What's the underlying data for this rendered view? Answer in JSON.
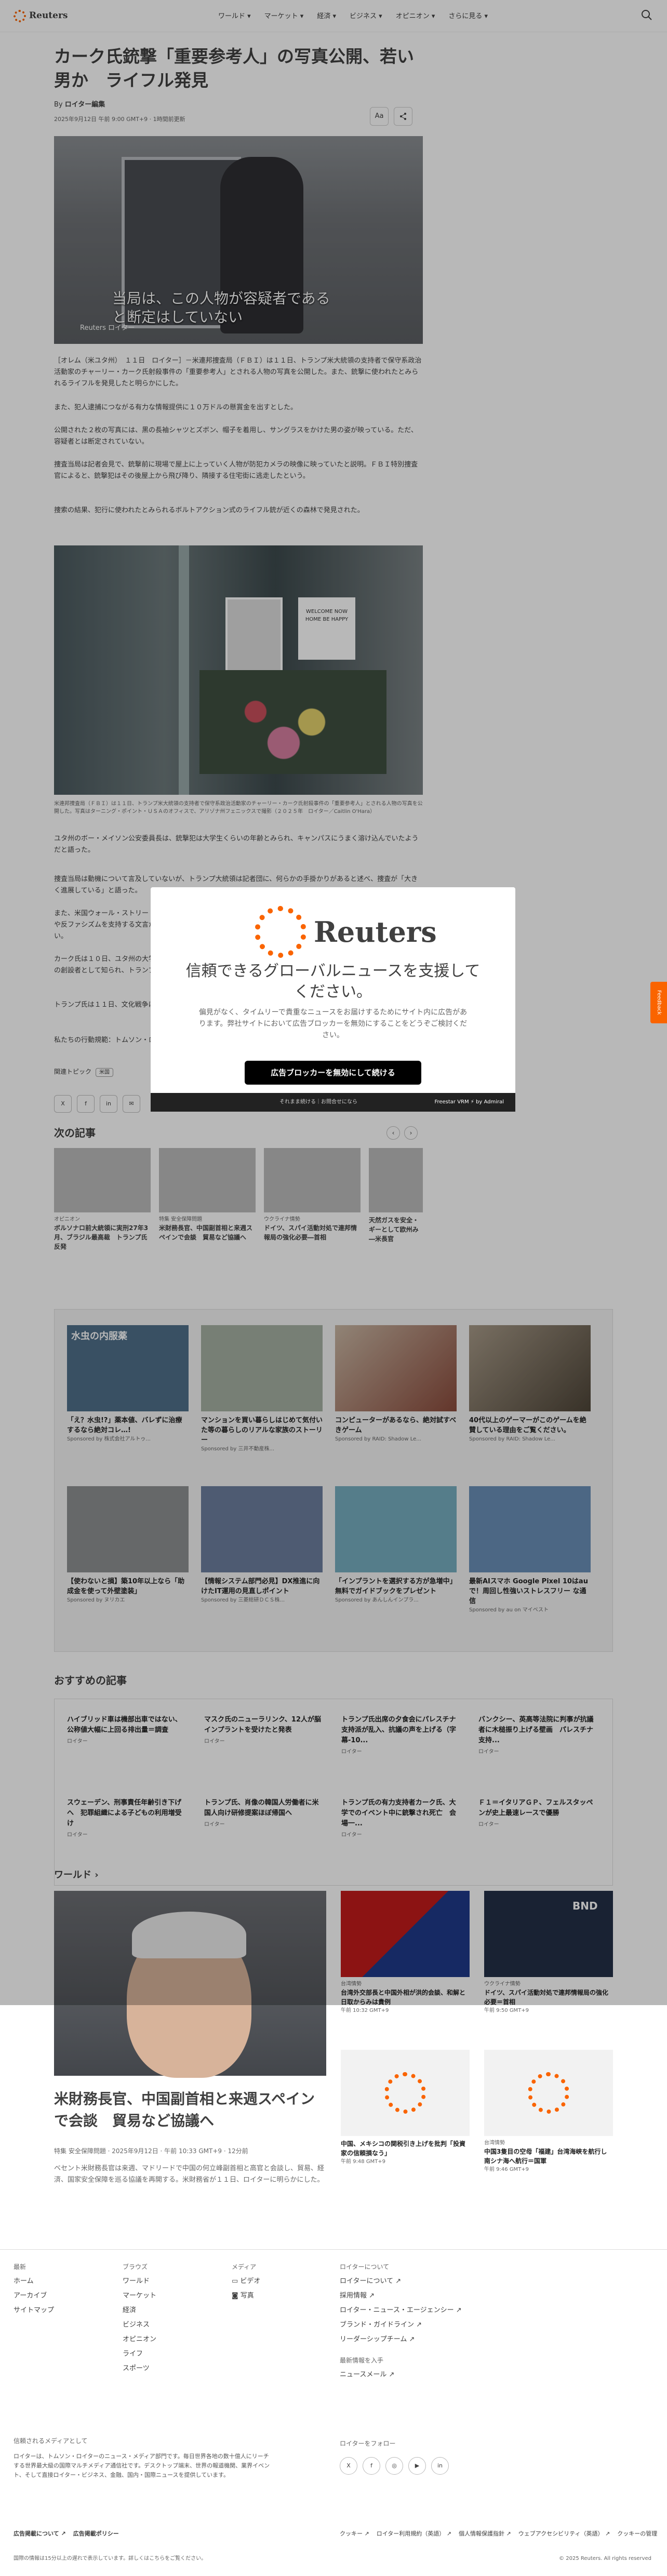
{
  "header": {
    "logo": "Reuters",
    "nav": [
      "ワールド ▾",
      "マーケット ▾",
      "経済 ▾",
      "ビジネス ▾",
      "オピニオン ▾",
      "さらに見る ▾"
    ]
  },
  "article": {
    "title": "カーク氏銃撃「重要参考人」の写真公開、若い男か　ライフル発見",
    "byline_prefix": "By",
    "byline_name": "ロイター編集",
    "date": "2025年9月12日 午前 9:00 GMT+9 · 1時間前更新",
    "font_button": "Aa",
    "photo1_caption_overlay": "当局は、この人物が容疑者であると断定はしていない",
    "photo1_watermark": "Reuters ロイター",
    "paragraphs": [
      "［オレム（米ユタ州）　１１日　ロイター］－米連邦捜査局（ＦＢＩ）は１１日、トランプ米大統領の支持者で保守系政治活動家のチャーリー・カーク氏射殺事件の「重要参考人」とされる人物の写真を公開した。また、銃撃に使われたとみられるライフルを発見したと明らかにした。",
      "また、犯人逮捕につながる有力な情報提供に１０万ドルの懸賞金を出すとした。",
      "公開された２枚の写真には、黒の長袖シャツとズボン、帽子を着用し、サングラスをかけた男の姿が映っている。ただ、容疑者とは断定されていない。",
      "捜査当局は記者会見で、銃撃前に現場で屋上に上っていく人物が防犯カメラの映像に映っていたと説明。ＦＢＩ特別捜査官によると、銃撃犯はその後屋上から飛び降り、隣接する住宅街に逃走したという。",
      "捜索の結果、犯行に使われたとみられるボルトアクション式のライフル銃が近くの森林で発見された。"
    ],
    "photo2_sign": "WELCOME NOW HOME BE HAPPY",
    "photo2_caption": "米連邦捜査局（ＦＢＩ）は１１日、トランプ米大統領の支持者で保守系政治活動家のチャーリー・カーク氏射殺事件の「重要参考人」とされる人物の写真を公開した。写真はターニング・ポイント・ＵＳＡのオフィスで、アリゾナ州フェニックスで撮影（２０２５年　ロイター／Caitlin O'Hara）",
    "paragraphs2": [
      "ユタ州のボー・メイソン公安委員長は、銃撃犯は大学生くらいの年齢とみられ、キャンパスにうまく溶け込んでいたようだと語った。",
      "捜査当局は動機について言及していないが、トランプ大統領は記者団に、何らかの手掛かりがあると述べ、捜査が「大きく進展している」と語った。",
      "また、米国ウォール・ストリート・ジャーナル紙は、ライフルの近くで見つかった薬きょうなどに、トランスジェンダーや反ファシズムを支持する文言が刻まれていたと報じた。ただ、この文書について、当局はその意味は明らかにしていない。",
      "カーク氏は１０日、ユタ州の大学で講演中に首を撃たれて死亡した。保守派の若者団体「ターニング・ポイントＵＳＡ」の創設者として知られ、トランプ氏の熱心な支持者だった。",
      "トランプ氏は１１日、文化戦争に巻き込まれた。"
    ],
    "contact": "私たちの行動規範：トムソン・ロイター「信頼の原則」",
    "topics_label": "関連トピック",
    "topic_tag": "米国",
    "share": [
      "X",
      "f",
      "in",
      "✉"
    ]
  },
  "modal": {
    "logo": "Reuters",
    "heading": "信頼できるグローバルニュースを支援してください。",
    "body": "偏見がなく、タイムリーで貴重なニュースをお届けするためにサイト内に広告があります。弊社サイトにおいて広告ブロッカーを無効にすることをどうぞご検討ください。",
    "button": "広告ブロッカーを無効にして続ける",
    "footer_left": "それまま続ける｜お問合せになら",
    "footer_right": "Freestar VRM ⚡ by Admiral",
    "feedback": "Feedback"
  },
  "next": {
    "heading": "次の記事",
    "prev": "‹",
    "next": "›",
    "cards": [
      {
        "kicker": "オピニオン",
        "title": "ボルソナロ前大統領に実刑27年3月、ブラジル最高裁　トランプ氏反発"
      },
      {
        "kicker": "特集 安全保障問題",
        "title": "米財務長官、中国副首相と来週スペインで会談　貿易など協議へ"
      },
      {
        "kicker": "ウクライナ情勢",
        "title": "ドイツ、スパイ活動対処で連邦情報局の強化必要―首相"
      },
      {
        "kicker": "",
        "title": "天然ガスを安全・ギーとして欧州み―米長官"
      }
    ]
  },
  "ads": [
    {
      "title": "「え？水虫!?」薬本値、バレずに治療するなら絶対コレ…!",
      "src": "Sponsored by 株式会社アルトゥ...",
      "label": "水虫の内服薬"
    },
    {
      "title": "マンションを買い暮らしはじめて気付いた等の暮らしのリアルな家族のストーリー",
      "src": "Sponsored by 三井不動産株..."
    },
    {
      "title": "コンピューターがあるなら、絶対試すべきゲーム",
      "src": "Sponsored by RAID: Shadow Le..."
    },
    {
      "title": "40代以上のゲーマーがこのゲームを絶賛している理由をご覧ください。",
      "src": "Sponsored by RAID: Shadow Le..."
    },
    {
      "title": "【使わないと損】築10年以上なら「助成金を使って外壁塗装」",
      "src": "Sponsored by ヌリカエ"
    },
    {
      "title": "【情報システム部門必見】DX推進に向けたIT運用の見直しポイント",
      "src": "Sponsored by 三菱総研ＤＣＳ株..."
    },
    {
      "title": "「インプラントを選択する方が急増中」無料でガイドブックをプレゼント",
      "src": "Sponsored by あんしんインプラ..."
    },
    {
      "title": "最新AIスマホ Google Pixel 10はauで！周回し性強いストレスフリー な通信",
      "src": "Sponsored by au on マイベスト"
    }
  ],
  "recommended": {
    "heading": "おすすめの記事",
    "items": [
      {
        "title": "ハイブリッド車は機部出車ではない、公称値大幅に上回る排出量＝調査",
        "src": "ロイター"
      },
      {
        "title": "マスク氏のニューラリンク、12人が脳インプラントを受けたと発表",
        "src": "ロイター"
      },
      {
        "title": "トランプ氏出席の夕食会にパレスチナ支持派が乱入、抗議の声を上げる（字幕-10...",
        "src": "ロイター"
      },
      {
        "title": "バンクシー、英高等法院に判事が抗議者に木槌振り上げる壁画　パレスチナ支持...",
        "src": "ロイター"
      },
      {
        "title": "スウェーデン、刑事責任年齢引き下げへ　犯罪組織による子どもの利用増受け",
        "src": "ロイター"
      },
      {
        "title": "トランプ氏、肖像の韓国人労働者に米国人向け研修提案ほぼ帰国へ",
        "src": "ロイター"
      },
      {
        "title": "トランプ氏の有力支持者カーク氏、大学でのイベント中に銃撃され死亡　会場一...",
        "src": "ロイター"
      },
      {
        "title": "Ｆ１＝イタリアＧＰ、フェルスタッペンが史上最速レースで優勝",
        "src": "ロイター"
      }
    ]
  },
  "world": {
    "heading": "ワールド ›",
    "main_title": "米財務長官、中国副首相と来週スペインで会談　貿易など協議へ",
    "main_meta": "特集 安全保障問題 · 2025年9月12日 · 午前 10:33 GMT+9 · 12分前",
    "main_desc": "ベセント米財務長官は来週、マドリードで中国の何立峰副首相と高官と会談し、貿易、経済、国家安全保障を巡る協議を再開する。米財務省が１１日、ロイターに明らかにした。",
    "cards": [
      {
        "kicker": "台湾情勢",
        "title": "台湾外交部長と中国外相が洪的会談、和解と日取からみは貴例",
        "date": "午前 10:32 GMT+9"
      },
      {
        "kicker": "ウクライナ情勢",
        "title": "ドイツ、スパイ活動対処で連邦情報局の強化必要＝首相",
        "date": "午前 9:50 GMT+9",
        "img_label": "BND"
      },
      {
        "kicker": "",
        "title": "中国、メキシコの関税引き上げを批判「投資家の信頼損なう」",
        "date": "午前 9:48 GMT+9"
      },
      {
        "kicker": "台湾情勢",
        "title": "中国3隻目の空母「福建」台湾海峡を航行し南シナ海へ航行＝国軍",
        "date": "午前 9:46 GMT+9"
      }
    ]
  },
  "footer": {
    "col1": {
      "head": "最新",
      "items": [
        "ホーム",
        "アーカイブ",
        "サイトマップ"
      ]
    },
    "col2": {
      "head": "ブラウズ",
      "items": [
        "ワールド",
        "マーケット",
        "経済",
        "ビジネス",
        "オピニオン",
        "ライフ",
        "スポーツ"
      ]
    },
    "col3": {
      "head": "メディア",
      "items": [
        "ビデオ",
        "写真"
      ]
    },
    "col4": {
      "head": "ロイターについて",
      "items": [
        "ロイターについて ↗",
        "採用情報 ↗",
        "ロイター・ニュース・エージェンシー ↗",
        "ブランド・ガイドライン ↗",
        "リーダーシップチーム ↗"
      ]
    },
    "col4b": {
      "head": "最新情報を入手",
      "items": [
        "ニュースメール ↗"
      ]
    },
    "media_head": "信頼されるメディアとして",
    "media_text": "ロイターは、トムソン・ロイターのニュース・メディア部門です。毎日世界各地の数十億人にリーチする世界最大級の国際マルチメディア通信社です。デスクトップ端末、世界の報道機関、業界イベント、そして直接ロイター・ビジネス、金融、国内・国際ニュースを提供しています。",
    "follow_head": "ロイターをフォロー",
    "social": [
      "X",
      "f",
      "◎",
      "▶",
      "in"
    ],
    "bottom": [
      "広告掲載について ↗",
      "広告掲載ポリシー"
    ],
    "bottom2": [
      "クッキー ↗",
      "ロイター利用規約（英語） ↗",
      "個人情報保護指針 ↗",
      "ウェブアクセシビリティ（英語） ↗",
      "クッキーの管理"
    ],
    "note": "国際の情報は15分以上の遅れで表示しています。詳しくはこちらをご覧ください。",
    "copyright": "© 2025 Reuters. All rights reserved"
  }
}
